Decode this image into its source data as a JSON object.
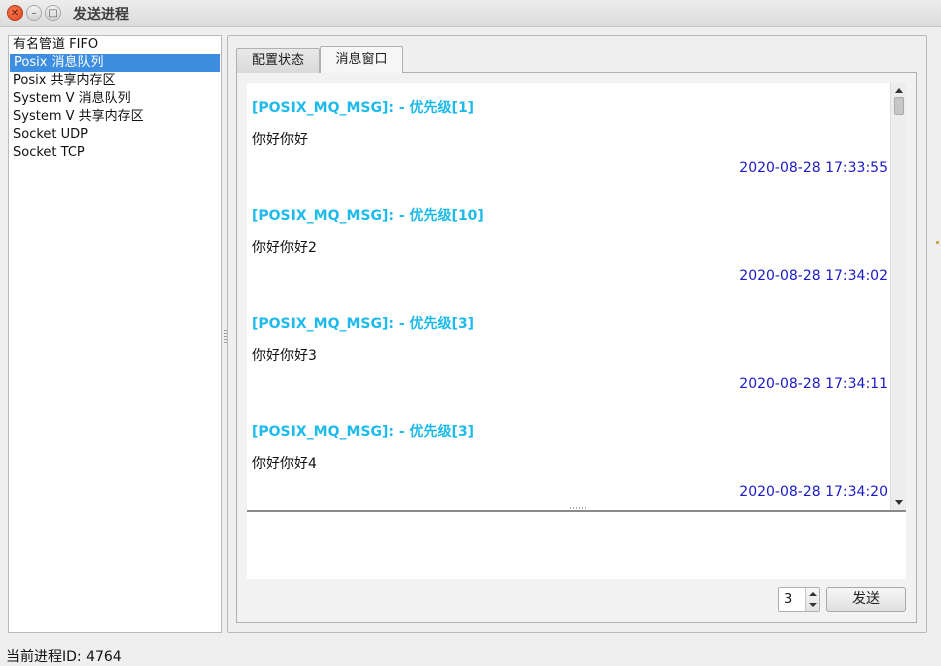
{
  "window": {
    "title": "发送进程",
    "close_glyph": "✕",
    "min_glyph": "–",
    "max_glyph": "□"
  },
  "sidebar": {
    "items": [
      {
        "label": "有名管道 FIFO",
        "selected": false
      },
      {
        "label": "Posix 消息队列",
        "selected": true
      },
      {
        "label": "Posix 共享内存区",
        "selected": false
      },
      {
        "label": "System V 消息队列",
        "selected": false
      },
      {
        "label": "System V 共享内存区",
        "selected": false
      },
      {
        "label": "Socket UDP",
        "selected": false
      },
      {
        "label": "Socket TCP",
        "selected": false
      }
    ]
  },
  "tabs": {
    "config_label": "配置状态",
    "messages_label": "消息窗口",
    "active": "消息窗口"
  },
  "messages": [
    {
      "header": "[POSIX_MQ_MSG]: - 优先级[1]",
      "body": "你好你好",
      "time": "2020-08-28 17:33:55"
    },
    {
      "header": "[POSIX_MQ_MSG]: - 优先级[10]",
      "body": "你好你好2",
      "time": "2020-08-28 17:34:02"
    },
    {
      "header": "[POSIX_MQ_MSG]: - 优先级[3]",
      "body": "你好你好3",
      "time": "2020-08-28 17:34:11"
    },
    {
      "header": "[POSIX_MQ_MSG]: - 优先级[3]",
      "body": "你好你好4",
      "time": "2020-08-28 17:34:20"
    }
  ],
  "composer": {
    "text": "",
    "priority_value": "3",
    "send_label": "发送"
  },
  "status": {
    "pid_text": "当前进程ID: 4764"
  },
  "colors": {
    "selection": "#3d8ee0",
    "msg_header": "#1ebaeb",
    "msg_time": "#1a1ac8"
  }
}
